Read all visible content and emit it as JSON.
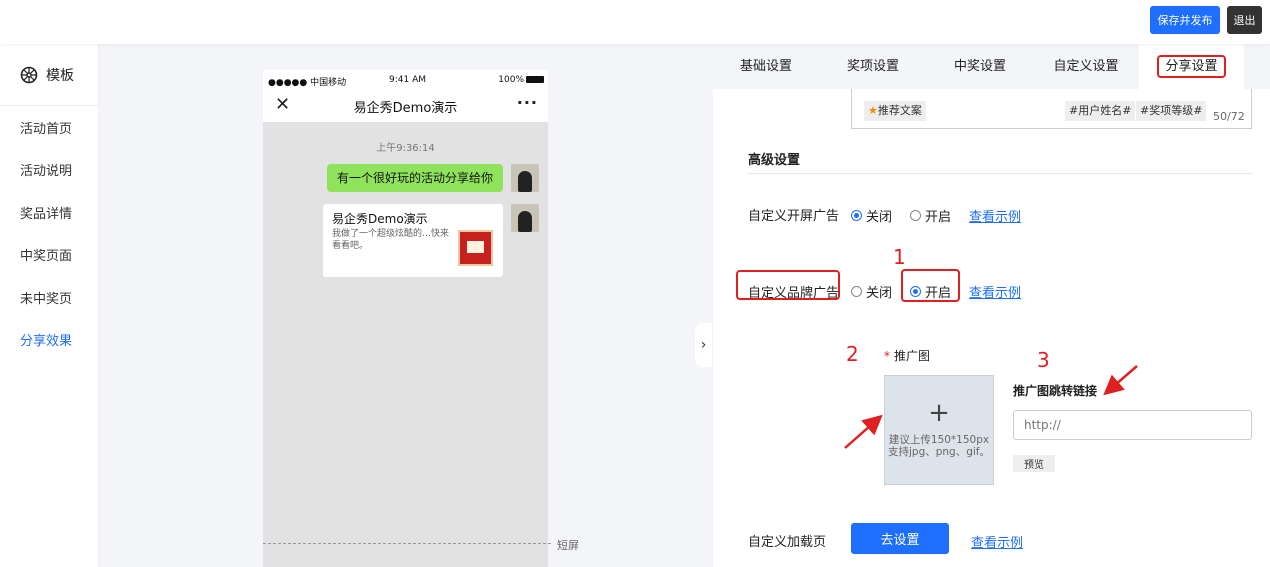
{
  "topbar": {
    "publish_label": "保存并发布",
    "exit_label": "退出"
  },
  "leftnav": {
    "header_label": "模板",
    "items": [
      {
        "label": "活动首页"
      },
      {
        "label": "活动说明"
      },
      {
        "label": "奖品详情"
      },
      {
        "label": "中奖页面"
      },
      {
        "label": "未中奖页"
      },
      {
        "label": "分享效果",
        "active": true
      }
    ]
  },
  "phone": {
    "carrier": "●●●●● 中国移动",
    "time": "9:41 AM",
    "battery": "100%",
    "title": "易企秀Demo演示",
    "chat_time": "上午9:36:14",
    "message": "有一个很好玩的活动分享给你",
    "card_title": "易企秀Demo演示",
    "card_desc": "我做了一个超级炫酷的…快来看看吧。",
    "short_screen_label": "短屏"
  },
  "tabs": [
    {
      "label": "基础设置"
    },
    {
      "label": "奖项设置"
    },
    {
      "label": "中奖设置"
    },
    {
      "label": "自定义设置"
    },
    {
      "label": "分享设置",
      "active": true
    }
  ],
  "share_text": {
    "tags": [
      "推荐文案",
      "#用户姓名#",
      "#奖项等级#"
    ],
    "counter": "50/72"
  },
  "advanced": {
    "title": "高级设置",
    "splash_ad_label": "自定义开屏广告",
    "brand_ad_label": "自定义品牌广告",
    "loading_page_label": "自定义加载页",
    "off_label": "关闭",
    "on_label": "开启",
    "view_example": "查看示例",
    "splash_ad_value": "关闭",
    "brand_ad_value": "开启",
    "promo_image_label": "推广图",
    "upload_hint": "建议上传150*150px 支持jpg、png、gif。",
    "promo_link_label": "推广图跳转链接",
    "promo_link_placeholder": "http://",
    "preview_label": "预览",
    "goset_label": "去设置"
  },
  "annotations": {
    "n1": "1",
    "n2": "2",
    "n3": "3"
  },
  "colors": {
    "accent": "#1e6fff",
    "annotation_red": "#e02020",
    "chat_green": "#8fe35a"
  }
}
